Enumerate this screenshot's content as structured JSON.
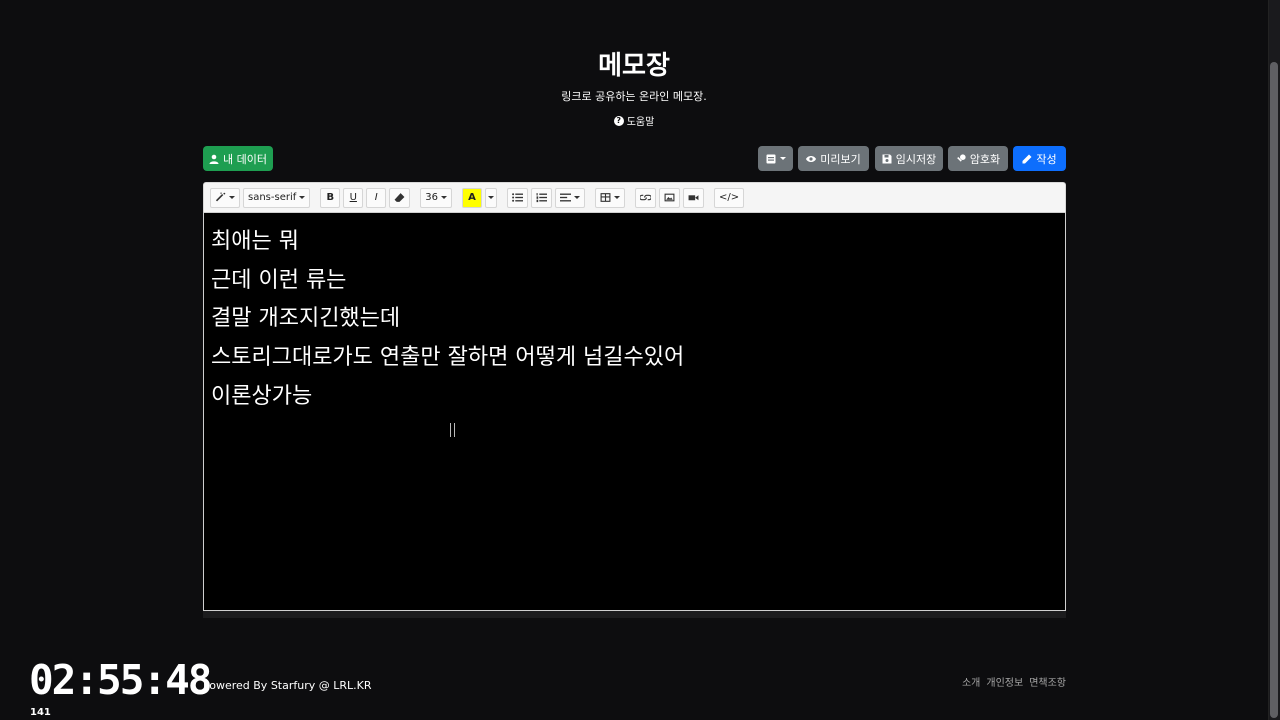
{
  "header": {
    "title": "메모장",
    "subtitle": "링크로 공유하는 온라인 메모장.",
    "help_label": "도움말"
  },
  "actions": {
    "my_data_label": "내 데이터",
    "preview_label": "미리보기",
    "save_temp_label": "임시저장",
    "encrypt_label": "암호화",
    "write_label": "작성"
  },
  "toolbar": {
    "font_family": "sans-serif",
    "font_size": "36",
    "bold": "B",
    "underline": "U",
    "italic": "I",
    "highlight": "A",
    "code": "</>"
  },
  "editor": {
    "lines": [
      "최애는 뭐",
      "근데 이런 류는",
      "결말 개조지긴했는데",
      "스토리그대로가도 연출만 잘하면 어떻게 넘길수있어",
      "이론상가능"
    ]
  },
  "footer": {
    "clock": "02:55:48",
    "counter": "141",
    "powered": "Powered By Starfury @ LRL.KR",
    "links": [
      "소개",
      "개인정보",
      "면책조항"
    ]
  },
  "colors": {
    "background": "#0d0d0f",
    "green": "#1e9e51",
    "gray": "#6c7378",
    "blue": "#0d6efd",
    "highlight": "#ffff00"
  }
}
